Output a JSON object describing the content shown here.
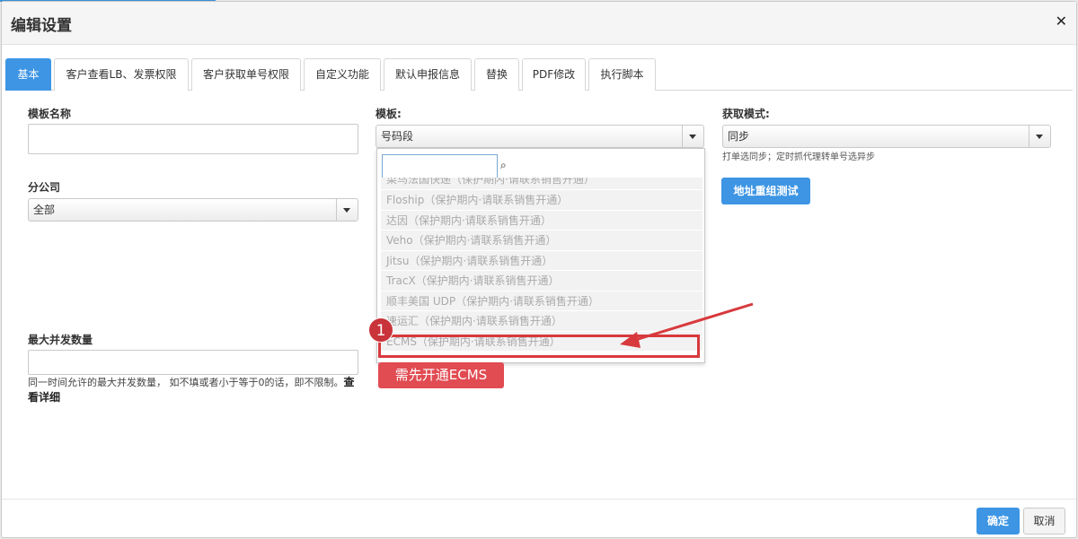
{
  "modal": {
    "title": "编辑设置",
    "close_symbol": "✕",
    "close_icon": "close-icon"
  },
  "tabs": [
    {
      "label": "基本",
      "active": true
    },
    {
      "label": "客户查看LB、发票权限",
      "active": false
    },
    {
      "label": "客户获取单号权限",
      "active": false
    },
    {
      "label": "自定义功能",
      "active": false
    },
    {
      "label": "默认申报信息",
      "active": false
    },
    {
      "label": "替换",
      "active": false
    },
    {
      "label": "PDF修改",
      "active": false
    },
    {
      "label": "执行脚本",
      "active": false
    }
  ],
  "form": {
    "template_name_label": "模板名称",
    "template_name_value": "",
    "template_label": "模板:",
    "template_selected": "号码段",
    "fetch_mode_label": "获取模式:",
    "fetch_mode_selected": "同步",
    "fetch_mode_help": "打单选同步；定时抓代理转单号选异步",
    "address_test_button": "地址重组测试",
    "branch_label": "分公司",
    "branch_selected": "全部",
    "max_concurrency_label": "最大并发数量",
    "max_concurrency_value": "",
    "max_concurrency_help": "同一时间允许的最大并发数量， 如不填或者小于等于0的话，即不限制。",
    "details_link": "查看详细"
  },
  "dropdown": {
    "search_value": "",
    "search_icon": "search-icon",
    "items": [
      "菜鸟法国快递（保护期内·请联系销售开通）",
      "Floship（保护期内·请联系销售开通）",
      "达因（保护期内·请联系销售开通）",
      "Veho（保护期内·请联系销售开通）",
      "Jitsu（保护期内·请联系销售开通）",
      "TracX（保护期内·请联系销售开通）",
      "顺丰美国 UDP（保护期内·请联系销售开通）",
      "速运汇（保护期内·请联系销售开通）",
      "ECMS（保护期内·请联系销售开通）"
    ]
  },
  "annotation": {
    "badge_number": "1",
    "tip_text": "需先开通ECMS",
    "color": "#d8393d"
  },
  "footer": {
    "confirm_label": "确定",
    "cancel_label": "取消"
  },
  "colors": {
    "primary": "#3d95e4",
    "annotation_red": "#d8393d"
  }
}
